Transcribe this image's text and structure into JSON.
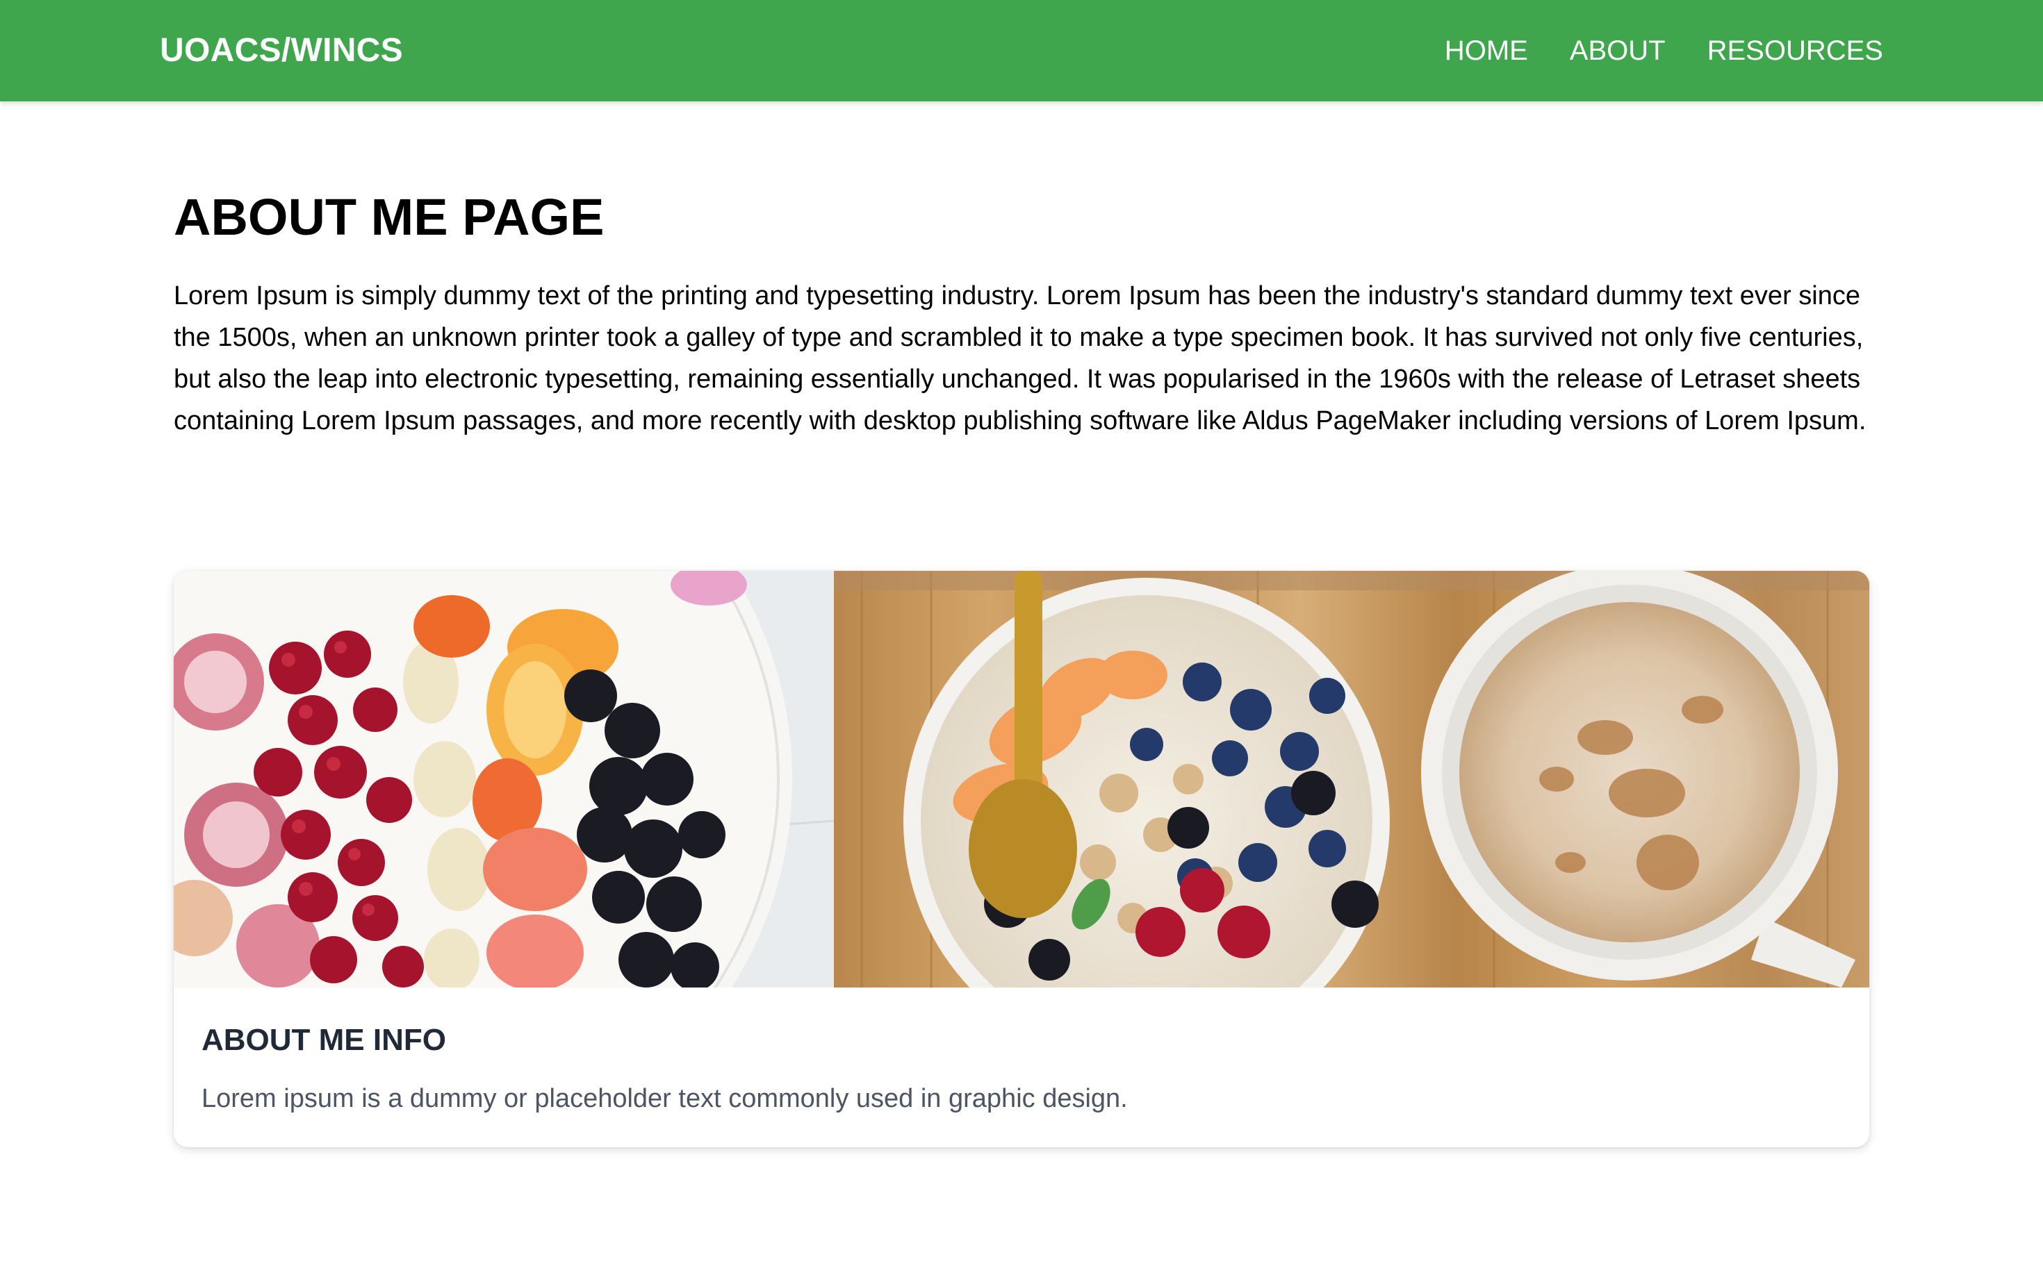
{
  "navbar": {
    "brand": "UOACS/WINCS",
    "links": [
      "HOME",
      "ABOUT",
      "RESOURCES"
    ],
    "background_color": "#3fa64d"
  },
  "main": {
    "title": "ABOUT ME PAGE",
    "intro": "Lorem Ipsum is simply dummy text of the printing and typesetting industry. Lorem Ipsum has been the industry's standard dummy text ever since the 1500s, when an unknown printer took a galley of type and scrambled it to make a type specimen book. It has survived not only five centuries, but also the leap into electronic typesetting, remaining essentially unchanged. It was popularised in the 1960s with the release of Letraset sheets containing Lorem Ipsum passages, and more recently with desktop publishing software like Aldus PageMaker including versions of Lorem Ipsum."
  },
  "card": {
    "image": "food-bowls-photo",
    "title": "ABOUT ME INFO",
    "text": "Lorem ipsum is a dummy or placeholder text commonly used in graphic design."
  }
}
